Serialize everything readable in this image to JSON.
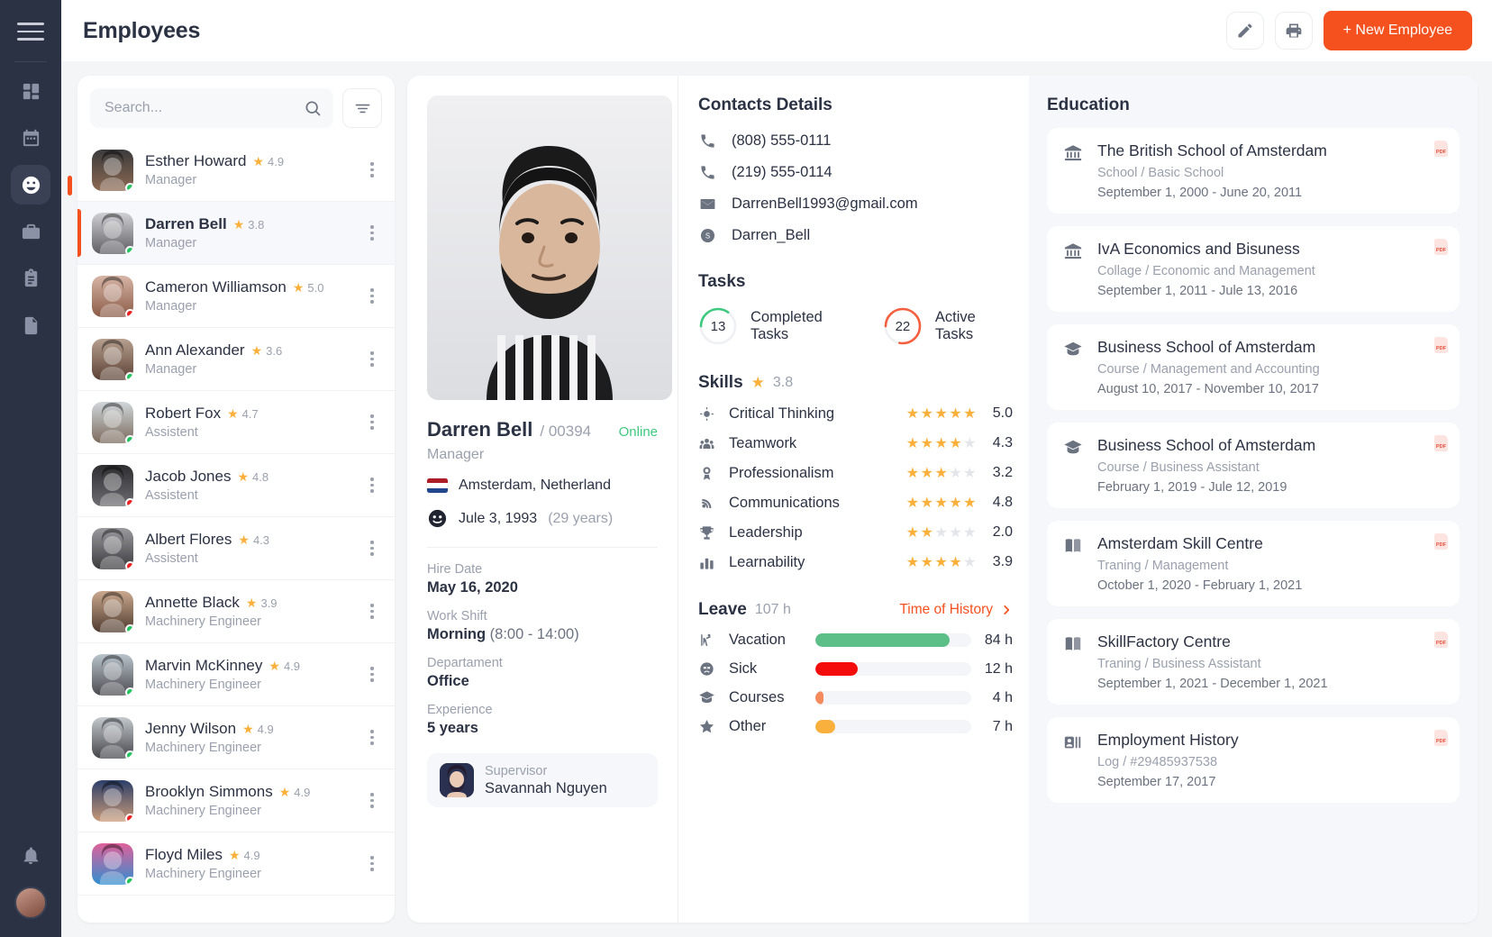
{
  "sidebar": {
    "menu_icon": "hamburger-icon",
    "items": [
      {
        "name": "dashboard",
        "icon": "grid-icon",
        "active": false
      },
      {
        "name": "calendar",
        "icon": "calendar-icon",
        "active": false
      },
      {
        "name": "employees",
        "icon": "people-icon",
        "active": true
      },
      {
        "name": "jobs",
        "icon": "briefcase-icon",
        "active": false
      },
      {
        "name": "reports",
        "icon": "clipboard-icon",
        "active": false
      },
      {
        "name": "documents",
        "icon": "document-icon",
        "active": false
      }
    ],
    "notifications_icon": "bell-icon",
    "user_avatar": "user-avatar"
  },
  "header": {
    "title": "Employees",
    "edit_icon": "pencil-icon",
    "print_icon": "printer-icon",
    "new_employee_label": "+ New Employee",
    "accent_color": "#f4511e"
  },
  "search": {
    "placeholder": "Search...",
    "value": "",
    "icon": "search-icon",
    "filter_icon": "filter-icon"
  },
  "employees": [
    {
      "name": "Esther Howard",
      "rating": "4.9",
      "role": "Manager",
      "status": "online",
      "selected": false
    },
    {
      "name": "Darren Bell",
      "rating": "3.8",
      "role": "Manager",
      "status": "online",
      "selected": true
    },
    {
      "name": "Cameron Williamson",
      "rating": "5.0",
      "role": "Manager",
      "status": "offline",
      "selected": false
    },
    {
      "name": "Ann Alexander",
      "rating": "3.6",
      "role": "Manager",
      "status": "online",
      "selected": false
    },
    {
      "name": "Robert Fox",
      "rating": "4.7",
      "role": "Assistent",
      "status": "online",
      "selected": false
    },
    {
      "name": "Jacob Jones",
      "rating": "4.8",
      "role": "Assistent",
      "status": "offline",
      "selected": false
    },
    {
      "name": "Albert Flores",
      "rating": "4.3",
      "role": "Assistent",
      "status": "offline",
      "selected": false
    },
    {
      "name": "Annette Black",
      "rating": "3.9",
      "role": "Machinery Engineer",
      "status": "online",
      "selected": false
    },
    {
      "name": "Marvin McKinney",
      "rating": "4.9",
      "role": "Machinery Engineer",
      "status": "online",
      "selected": false
    },
    {
      "name": "Jenny Wilson",
      "rating": "4.9",
      "role": "Machinery Engineer",
      "status": "online",
      "selected": false
    },
    {
      "name": "Brooklyn Simmons",
      "rating": "4.9",
      "role": "Machinery Engineer",
      "status": "offline",
      "selected": false
    },
    {
      "name": "Floyd Miles",
      "rating": "4.9",
      "role": "Machinery Engineer",
      "status": "online",
      "selected": false
    }
  ],
  "profile": {
    "name": "Darren Bell",
    "id": "/ 00394",
    "status": "Online",
    "status_color": "#3fc97f",
    "role": "Manager",
    "location": "Amsterdam, Netherland",
    "birthday": "Jule 3, 1993",
    "age": "(29 years)",
    "fields": [
      {
        "label": "Hire Date",
        "value": "May 16, 2020",
        "extra": ""
      },
      {
        "label": "Work Shift",
        "value": "Morning",
        "extra": " (8:00 - 14:00)"
      },
      {
        "label": "Departament",
        "value": "Office",
        "extra": ""
      },
      {
        "label": "Experience",
        "value": "5 years",
        "extra": ""
      }
    ],
    "supervisor_label": "Supervisor",
    "supervisor_name": "Savannah Nguyen"
  },
  "contacts": {
    "title": "Contacts Details",
    "items": [
      {
        "icon": "phone-icon",
        "value": "(808) 555-0111"
      },
      {
        "icon": "phone-icon",
        "value": "(219) 555-0114"
      },
      {
        "icon": "mail-icon",
        "value": "DarrenBell1993@gmail.com"
      },
      {
        "icon": "skype-icon",
        "value": "Darren_Bell"
      }
    ]
  },
  "tasks": {
    "title": "Tasks",
    "completed": {
      "count": "13",
      "label": "Completed Tasks",
      "color": "#3fc97f",
      "percent": 35
    },
    "active": {
      "count": "22",
      "label": "Active Tasks",
      "color": "#f4603e",
      "percent": 78
    }
  },
  "skills": {
    "title": "Skills",
    "overall": "3.8",
    "items": [
      {
        "icon": "brain-icon",
        "name": "Critical Thinking",
        "stars": 5,
        "value": "5.0"
      },
      {
        "icon": "teamwork-icon",
        "name": "Teamwork",
        "stars": 4,
        "value": "4.3"
      },
      {
        "icon": "medal-icon",
        "name": "Professionalism",
        "stars": 3,
        "value": "3.2"
      },
      {
        "icon": "signal-icon",
        "name": "Communications",
        "stars": 5,
        "value": "4.8"
      },
      {
        "icon": "trophy-icon",
        "name": "Leadership",
        "stars": 2,
        "value": "2.0"
      },
      {
        "icon": "chart-icon",
        "name": "Learnability",
        "stars": 4,
        "value": "3.9"
      }
    ]
  },
  "leave": {
    "title": "Leave",
    "total": "107 h",
    "link_label": "Time of History",
    "items": [
      {
        "icon": "vacation-icon",
        "name": "Vacation",
        "value": "84 h",
        "percent": 86,
        "color": "#5bbf87"
      },
      {
        "icon": "sick-icon",
        "name": "Sick",
        "value": "12 h",
        "percent": 27,
        "color": "#f40c0c"
      },
      {
        "icon": "courses-icon",
        "name": "Courses",
        "value": "4 h",
        "percent": 5,
        "color": "#f58a5d"
      },
      {
        "icon": "other-icon",
        "name": "Other",
        "value": "7 h",
        "percent": 13,
        "color": "#f9b03c"
      }
    ]
  },
  "education": {
    "title": "Education",
    "items": [
      {
        "icon": "bank-icon",
        "title": "The British School of Amsterdam",
        "sub": "School / Basic School",
        "date": "September 1, 2000 - June 20, 2011",
        "badge": "PDF"
      },
      {
        "icon": "bank-icon",
        "title": "IvA Economics and Bisuness",
        "sub": "Collage / Economic and Management",
        "date": "September 1, 2011 - Jule 13, 2016",
        "badge": "PDF"
      },
      {
        "icon": "graduation-icon",
        "title": "Business School of Amsterdam",
        "sub": "Course / Management and Accounting",
        "date": "August 10, 2017 - November 10, 2017",
        "badge": "PDF"
      },
      {
        "icon": "graduation-icon",
        "title": "Business School of Amsterdam",
        "sub": "Course / Business Assistant",
        "date": "February 1, 2019 - Jule 12, 2019",
        "badge": "PDF"
      },
      {
        "icon": "book-icon",
        "title": "Amsterdam Skill Centre",
        "sub": "Traning / Management",
        "date": "October 1, 2020 - February 1, 2021",
        "badge": "PDF"
      },
      {
        "icon": "book-icon",
        "title": "SkillFactory Centre",
        "sub": "Traning / Business Assistant",
        "date": "September 1, 2021 - December 1, 2021",
        "badge": "PDF"
      },
      {
        "icon": "id-card-icon",
        "title": "Employment History",
        "sub": "Log / #29485937538",
        "date": "September 17, 2017",
        "badge": "PDF"
      }
    ]
  }
}
